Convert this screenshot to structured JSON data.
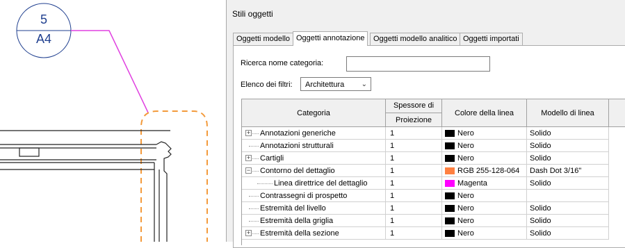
{
  "drawing": {
    "tag_number": "5",
    "tag_sheet": "A4",
    "leader_color": "#e040e0",
    "cloud_color": "#f39a3b"
  },
  "dialog": {
    "title": "Stili oggetti",
    "tabs": [
      {
        "label": "Oggetti modello",
        "active": false
      },
      {
        "label": "Oggetti annotazione",
        "active": true
      },
      {
        "label": "Oggetti modello analitico",
        "active": false
      },
      {
        "label": "Oggetti importati",
        "active": false
      }
    ],
    "search_label": "Ricerca nome categoria:",
    "search_value": "",
    "filter_label": "Elenco dei filtri:",
    "filter_value": "Architettura",
    "table": {
      "headers": {
        "category": "Categoria",
        "weight_top": "Spessore di",
        "weight_sub": "Proiezione",
        "color": "Colore della linea",
        "pattern": "Modello di linea"
      },
      "rows": [
        {
          "name": "Annotazioni generiche",
          "expander": "+",
          "weight": "1",
          "color_label": "Nero",
          "color_hex": "#000000",
          "pattern": "Solido",
          "level": 0
        },
        {
          "name": "Annotazioni strutturali",
          "expander": "",
          "weight": "1",
          "color_label": "Nero",
          "color_hex": "#000000",
          "pattern": "Solido",
          "level": 0
        },
        {
          "name": "Cartigli",
          "expander": "+",
          "weight": "1",
          "color_label": "Nero",
          "color_hex": "#000000",
          "pattern": "Solido",
          "level": 0
        },
        {
          "name": "Contorno del dettaglio",
          "expander": "−",
          "weight": "1",
          "color_label": "RGB 255-128-064",
          "color_hex": "#ff8040",
          "pattern": "Dash Dot 3/16\"",
          "level": 0
        },
        {
          "name": "Linea direttrice del dettaglio",
          "expander": "",
          "weight": "1",
          "color_label": "Magenta",
          "color_hex": "#ff00ff",
          "pattern": "Solido",
          "level": 1
        },
        {
          "name": "Contrassegni di prospetto",
          "expander": "",
          "weight": "1",
          "color_label": "Nero",
          "color_hex": "#000000",
          "pattern": "",
          "level": 0
        },
        {
          "name": "Estremità del livello",
          "expander": "",
          "weight": "1",
          "color_label": "Nero",
          "color_hex": "#000000",
          "pattern": "Solido",
          "level": 0
        },
        {
          "name": "Estremità della griglia",
          "expander": "",
          "weight": "1",
          "color_label": "Nero",
          "color_hex": "#000000",
          "pattern": "Solido",
          "level": 0
        },
        {
          "name": "Estremità della sezione",
          "expander": "+",
          "weight": "1",
          "color_label": "Nero",
          "color_hex": "#000000",
          "pattern": "Solido",
          "level": 0
        }
      ]
    }
  }
}
